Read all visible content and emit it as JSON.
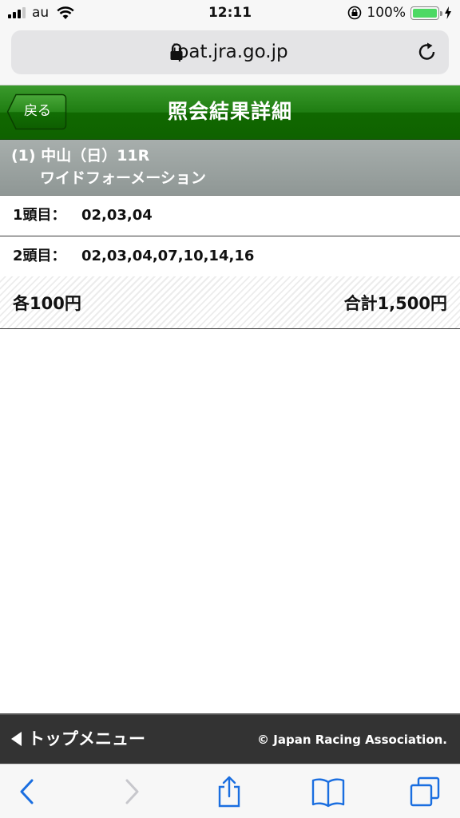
{
  "status_bar": {
    "carrier": "au",
    "time": "12:11",
    "battery_percent": "100%",
    "battery_color": "#4cd964"
  },
  "browser": {
    "url": "ipat.jra.go.jp"
  },
  "header": {
    "back_label": "戻る",
    "title": "照会結果詳細",
    "accent_color": "#1f7d12"
  },
  "race": {
    "line1": "(1) 中山（日）11R",
    "bet_type": "ワイドフォーメーション"
  },
  "selections": [
    {
      "label": "1頭目：",
      "value": "02,03,04"
    },
    {
      "label": "2頭目：",
      "value": "02,03,04,07,10,14,16"
    }
  ],
  "totals": {
    "per_bet": "各100円",
    "total": "合計1,500円"
  },
  "footer": {
    "top_menu": "トップメニュー",
    "copyright": "© Japan Racing Association."
  },
  "toolbar": {
    "icons": [
      "back-icon",
      "forward-icon",
      "share-icon",
      "bookmarks-icon",
      "tabs-icon"
    ]
  }
}
